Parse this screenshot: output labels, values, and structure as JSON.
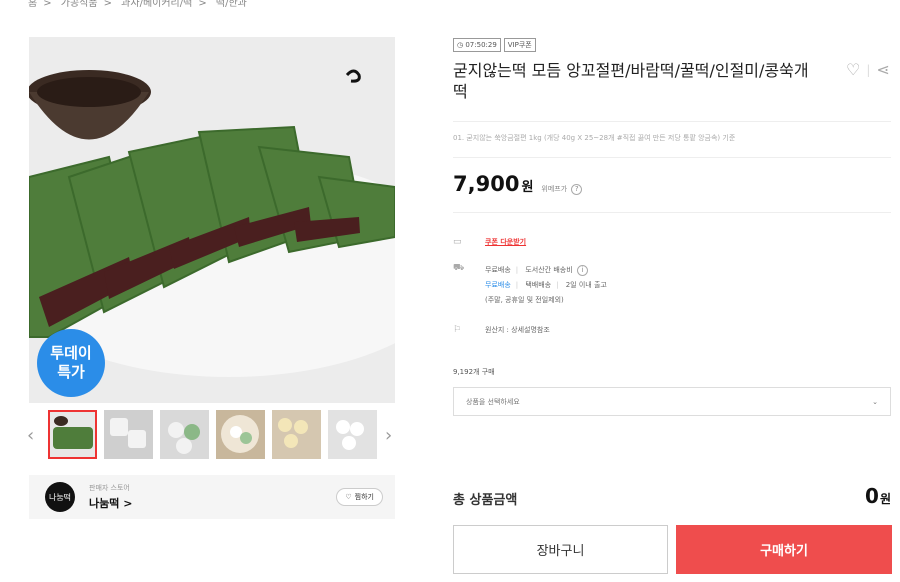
{
  "breadcrumb": [
    "홈",
    "가공식품",
    "과자/베이커리/떡",
    "떡/한과"
  ],
  "product": {
    "timer": "07:50:29",
    "vip_badge": "VIP쿠폰",
    "title": "굳지않는떡 모듬 앙꼬절편/바람떡/꿀떡/인절미/콩쑥개떡",
    "option_desc": "01. 굳지않는 쑥앙금절편 1kg (개당 40g X 25~28개 #직접 끓여 만든 저당 통팥 앙금속) 기준",
    "price": "7,900",
    "price_unit": "원",
    "price_label": "위메프가",
    "price_help": "?",
    "today_badge_line1": "투데이",
    "today_badge_line2": "특가"
  },
  "coupon": {
    "label": "쿠폰 다운받기"
  },
  "shipping": {
    "line1_a": "무료배송",
    "line1_b": "도서산간 배송비",
    "line2_a": "무료배송",
    "line2_b": "택배배송",
    "line2_c": "2일 이내 출고",
    "line3": "(주말, 공휴일 및 전일제외)",
    "origin": "원산지 : 상세설명참조"
  },
  "purchase_count": "9,192개 구매",
  "option_select": {
    "placeholder": "상품을 선택하세요"
  },
  "total": {
    "label": "총 상품금액",
    "value": "0",
    "unit": "원"
  },
  "buttons": {
    "cart": "장바구니",
    "buy": "구매하기"
  },
  "seller": {
    "logo_text": "나눔떡",
    "label": "판매자 스토어",
    "name": "나눔떡 >",
    "follow": "찜하기"
  },
  "icons": {
    "heart": "heart-icon",
    "share": "share-icon",
    "clock": "clock-icon",
    "coupon": "coupon-icon",
    "truck": "truck-icon",
    "flag": "flag-icon",
    "chevron": "chevron-down-icon"
  },
  "colors": {
    "accent_red": "#ef4d4d",
    "badge_blue": "#2b8de8",
    "coupon_red": "#e33"
  }
}
